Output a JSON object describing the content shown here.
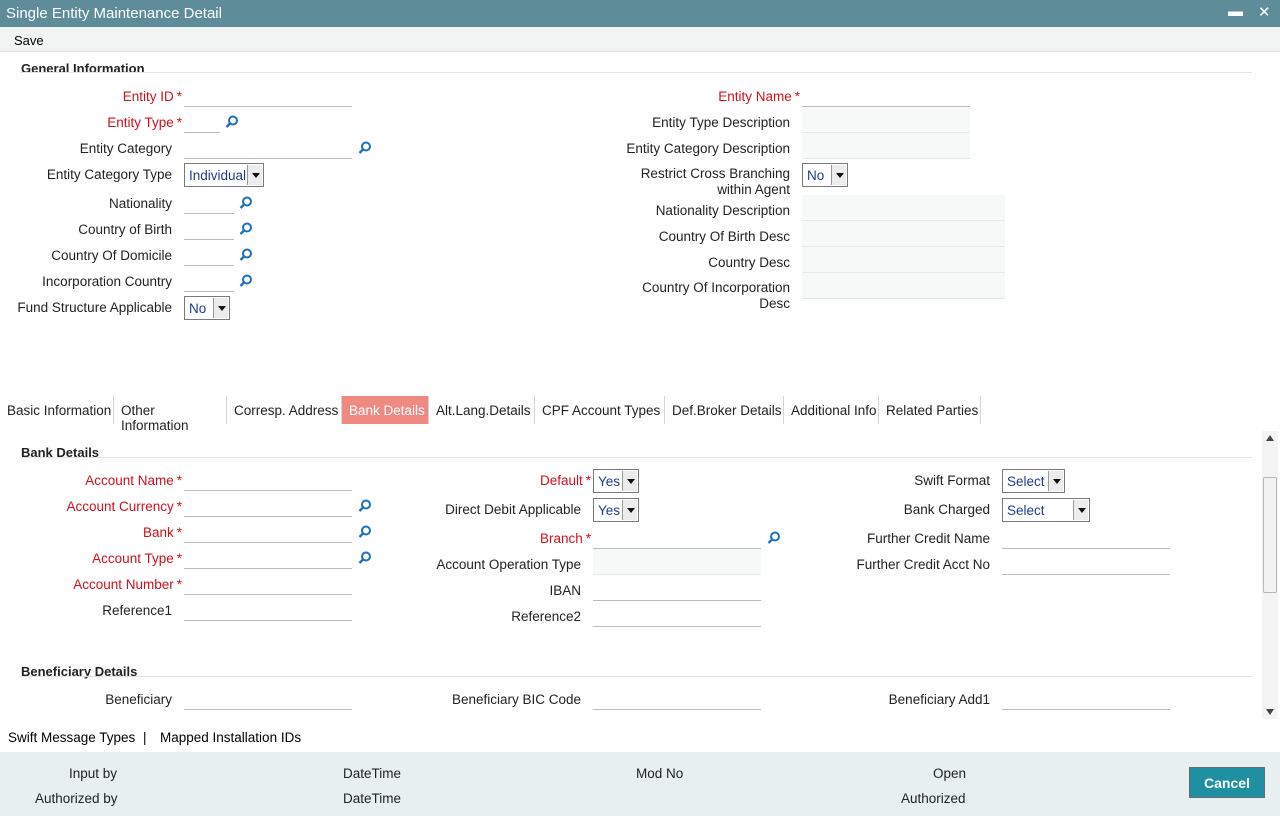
{
  "window": {
    "title": "Single Entity Maintenance Detail",
    "minimize": "▬",
    "close": "✕"
  },
  "menu": {
    "save": "Save"
  },
  "general": {
    "title": "General Information",
    "entity_id": "Entity ID",
    "entity_type": "Entity Type",
    "entity_category": "Entity Category",
    "entity_category_type": "Entity Category Type",
    "entity_category_type_value": "Individual",
    "nationality": "Nationality",
    "country_of_birth": "Country of Birth",
    "country_of_domicile": "Country Of Domicile",
    "incorporation_country": "Incorporation Country",
    "fund_structure": "Fund Structure Applicable",
    "fund_structure_value": "No",
    "entity_name": "Entity Name",
    "entity_type_desc": "Entity Type Description",
    "entity_category_desc": "Entity Category Description",
    "restrict_cross_branching": "Restrict Cross Branching within Agent",
    "restrict_cross_branching_value": "No",
    "nationality_desc": "Nationality Description",
    "country_birth_desc": "Country Of Birth Desc",
    "country_desc": "Country Desc",
    "country_incorp_desc": "Country Of Incorporation Desc"
  },
  "tabs": [
    "Basic Information",
    "Other Information",
    "Corresp. Address",
    "Bank Details",
    "Alt.Lang.Details",
    "CPF Account Types",
    "Def.Broker Details",
    "Additional Info",
    "Related Parties"
  ],
  "bank": {
    "title": "Bank Details",
    "account_name": "Account Name",
    "account_currency": "Account Currency",
    "bank": "Bank",
    "account_type": "Account Type",
    "account_number": "Account Number",
    "reference1": "Reference1",
    "default": "Default",
    "default_value": "Yes",
    "direct_debit": "Direct Debit Applicable",
    "direct_debit_value": "Yes",
    "branch": "Branch",
    "account_operation_type": "Account Operation Type",
    "iban": "IBAN",
    "reference2": "Reference2",
    "swift_format": "Swift Format",
    "swift_format_value": "Select",
    "bank_charged": "Bank Charged",
    "bank_charged_value": "Select",
    "further_credit_name": "Further Credit Name",
    "further_credit_acct": "Further Credit Acct No"
  },
  "beneficiary": {
    "title": "Beneficiary Details",
    "beneficiary": "Beneficiary",
    "bic": "Beneficiary BIC Code",
    "add1": "Beneficiary Add1"
  },
  "links": {
    "swift": "Swift Message Types",
    "sep": "|",
    "mapped": "Mapped Installation IDs"
  },
  "footer": {
    "input_by": "Input by",
    "authorized_by": "Authorized by",
    "datetime1": "DateTime",
    "datetime2": "DateTime",
    "mod_no": "Mod No",
    "open": "Open",
    "authorized": "Authorized",
    "cancel": "Cancel"
  },
  "colors": {
    "titlebar": "#5e8c98",
    "required": "#d0101a",
    "active_tab": "#ee8a82",
    "cancel": "#1f8fa2",
    "lens": "#1f6fc0"
  }
}
